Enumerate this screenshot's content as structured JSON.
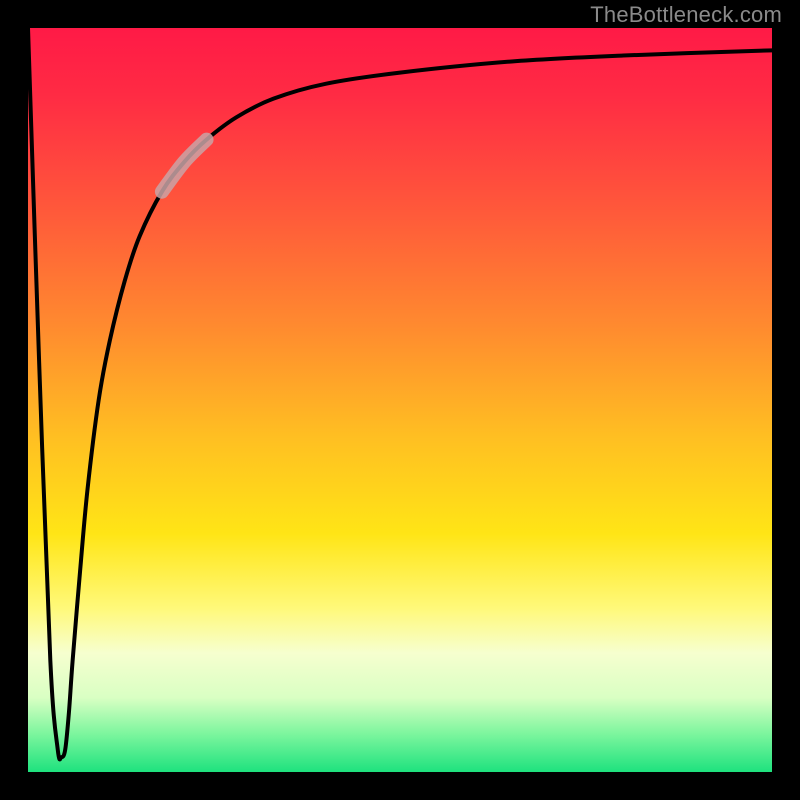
{
  "attribution": "TheBottleneck.com",
  "chart_data": {
    "type": "line",
    "title": "",
    "xlabel": "",
    "ylabel": "",
    "xlim": [
      0,
      100
    ],
    "ylim": [
      0,
      100
    ],
    "series": [
      {
        "name": "bottleneck-curve",
        "x": [
          0,
          1.5,
          3.0,
          4.0,
          4.5,
          5.0,
          5.5,
          6.0,
          7.0,
          8.0,
          9.5,
          11,
          13,
          15,
          18,
          21,
          24,
          28,
          33,
          40,
          50,
          65,
          80,
          100
        ],
        "values": [
          100,
          55,
          15,
          3,
          2,
          3,
          8,
          15,
          27,
          38,
          50,
          58,
          66,
          72,
          78,
          82,
          85,
          88,
          90.5,
          92.5,
          94,
          95.5,
          96.3,
          97
        ]
      }
    ],
    "highlight_segment": {
      "x_start": 18,
      "x_end": 24
    },
    "gradient_stops": [
      {
        "pos": 0.0,
        "color": "#ff1a46"
      },
      {
        "pos": 0.25,
        "color": "#ff5a3a"
      },
      {
        "pos": 0.55,
        "color": "#ffbf22"
      },
      {
        "pos": 0.78,
        "color": "#fff97a"
      },
      {
        "pos": 0.9,
        "color": "#d9ffc3"
      },
      {
        "pos": 1.0,
        "color": "#1ee27e"
      }
    ]
  }
}
